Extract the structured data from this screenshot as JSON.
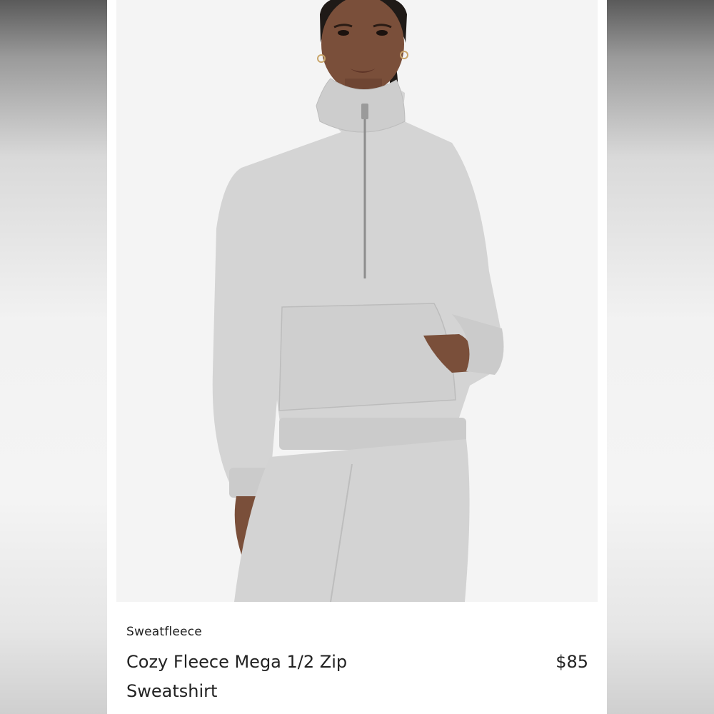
{
  "listing": {
    "brand": "Sweatfleece",
    "product_name": "Cozy Fleece Mega 1/2 Zip Sweatshirt",
    "price": "$85"
  },
  "photo": {
    "subject": "model wearing heather grey half-zip sweatshirt and matching sweatpants",
    "garment_color": "#d4d4d4",
    "background_color": "#f4f4f4"
  }
}
